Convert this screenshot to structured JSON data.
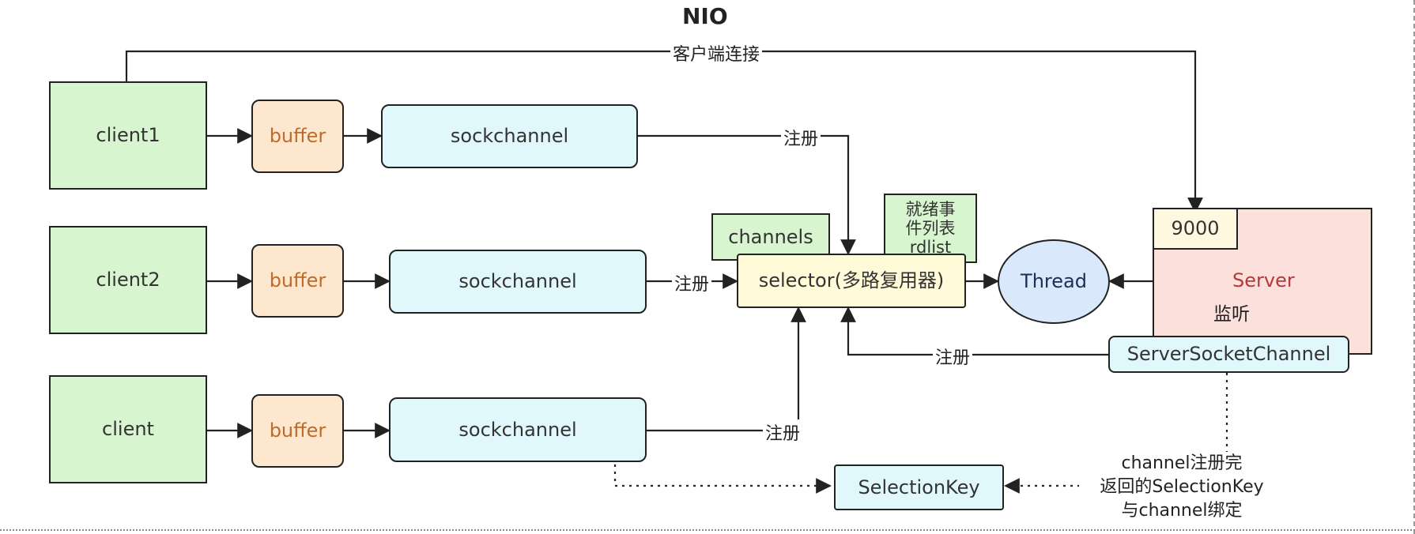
{
  "title": "NIO",
  "nodes": {
    "client1": "client1",
    "client2": "client2",
    "client3": "client",
    "buffer1": "buffer",
    "buffer2": "buffer",
    "buffer3": "buffer",
    "sock1": "sockchannel",
    "sock2": "sockchannel",
    "sock3": "sockchannel",
    "channels": "channels",
    "rdlist": [
      "就绪事",
      "件列表",
      "rdlist"
    ],
    "selector": "selector(多路复用器)",
    "thread": "Thread",
    "port": "9000",
    "server": "Server",
    "listen": "监听",
    "ssc": "ServerSocketChannel",
    "selection_key": "SelectionKey"
  },
  "edge_labels": {
    "connect": "客户端连接",
    "reg1": "注册",
    "reg2": "注册",
    "reg3": "注册",
    "reg_server": "注册"
  },
  "note": [
    "channel注册完",
    "返回的SelectionKey",
    "与channel绑定"
  ]
}
